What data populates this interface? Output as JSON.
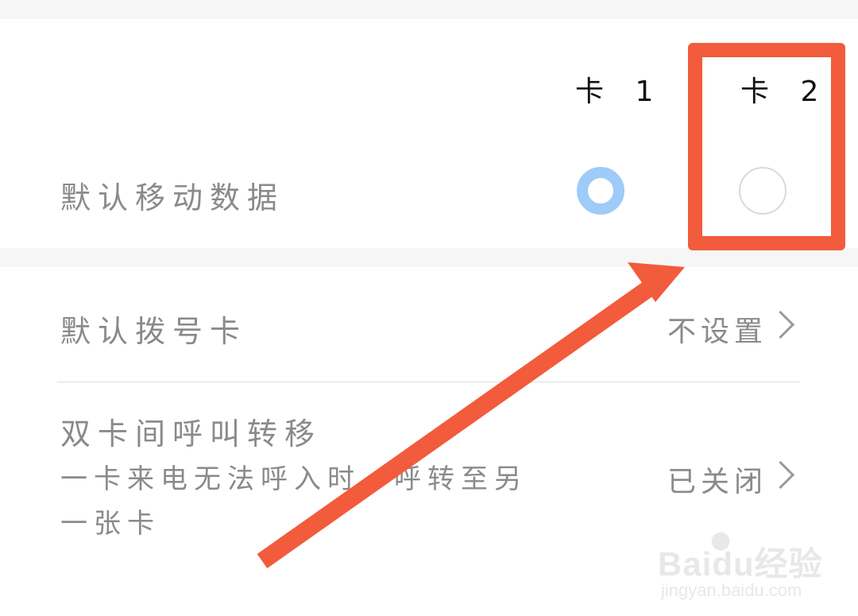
{
  "sim_section": {
    "card1_label": "卡 1",
    "card2_label": "卡 2",
    "default_data_label": "默认移动数据",
    "selected_card": 1
  },
  "list": {
    "default_dial": {
      "label": "默认拨号卡",
      "value": "不设置"
    },
    "call_transfer": {
      "label": "双卡间呼叫转移",
      "description": "一卡来电无法呼入时，呼转至另一张卡",
      "value": "已关闭"
    }
  },
  "annotation": {
    "color": "#f25b3c"
  },
  "watermark": {
    "brand": "Baidu经验",
    "url": "jingyan.baidu.com"
  },
  "colors": {
    "radio_selected": "#9ecbf7",
    "radio_unselected": "#dadada",
    "label_text": "#8a8a8a"
  }
}
